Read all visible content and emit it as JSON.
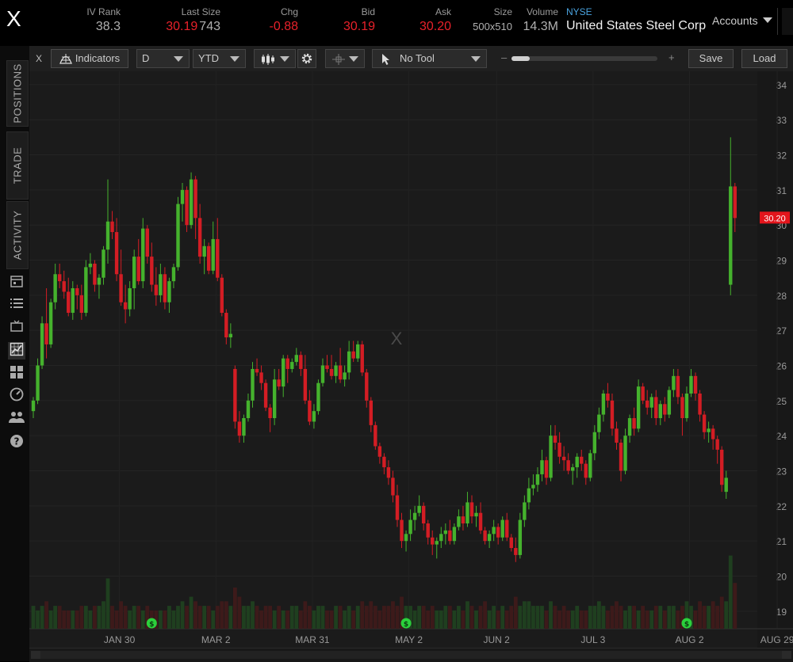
{
  "header": {
    "symbol": "X",
    "iv_rank_label": "IV Rank",
    "iv_rank": "38.3",
    "last_size_label": "Last Size",
    "last": "30.19",
    "last_size": "743",
    "chg_label": "Chg",
    "chg": "-0.88",
    "bid_label": "Bid",
    "bid": "30.19",
    "ask_label": "Ask",
    "ask": "30.20",
    "size_label": "Size",
    "size": "500x510",
    "volume_label": "Volume",
    "volume": "14.3M",
    "exchange": "NYSE",
    "company": "United States Steel Corp",
    "accounts": "Accounts"
  },
  "sidebar": {
    "tabs": [
      "POSITIONS",
      "TRADE",
      "ACTIVITY"
    ],
    "icons": [
      "calendar-icon",
      "list-icon",
      "tv-icon",
      "chart-icon",
      "grid-icon",
      "gauge-icon",
      "people-icon",
      "help-icon"
    ]
  },
  "toolbar": {
    "close": "X",
    "indicators": "Indicators",
    "interval": "D",
    "range": "YTD",
    "tool": "No Tool",
    "zoom_minus": "–",
    "zoom_plus": "+",
    "zoom_level": 0.12,
    "save": "Save",
    "load": "Load",
    "expand": ">"
  },
  "colors": {
    "up": "#45b22d",
    "down": "#d31d24",
    "price_tag": "#e3151c",
    "dividend": "#2bd13c"
  },
  "chart_data": {
    "type": "candlestick",
    "watermark": "X",
    "y_ticks": [
      19,
      20,
      21,
      22,
      23,
      24,
      25,
      26,
      27,
      28,
      29,
      30,
      31,
      32,
      33,
      34
    ],
    "ylim": [
      18.5,
      34.2
    ],
    "x_labels": [
      "JAN 30",
      "MAR 2",
      "MAR 31",
      "MAY 2",
      "JUN 2",
      "JUL 3",
      "AUG 2",
      "AUG 29"
    ],
    "price_tag": "30.20",
    "dividend_markers": [
      "JAN 30",
      "MAY 2",
      "AUG 2"
    ],
    "candles": [
      [
        24.7,
        25.1,
        24.5,
        25.0
      ],
      [
        25.0,
        26.2,
        24.9,
        26.0
      ],
      [
        26.0,
        27.4,
        25.9,
        27.2
      ],
      [
        27.2,
        28.2,
        26.2,
        26.6
      ],
      [
        26.6,
        27.9,
        26.5,
        27.8
      ],
      [
        27.8,
        28.9,
        27.6,
        28.6
      ],
      [
        28.6,
        28.9,
        28.2,
        28.4
      ],
      [
        28.4,
        28.7,
        27.9,
        28.1
      ],
      [
        28.1,
        28.5,
        27.4,
        27.5
      ],
      [
        27.5,
        28.4,
        27.3,
        28.2
      ],
      [
        28.2,
        28.3,
        27.6,
        28.0
      ],
      [
        28.0,
        28.3,
        27.3,
        27.5
      ],
      [
        27.5,
        29.0,
        27.4,
        28.8
      ],
      [
        28.8,
        29.2,
        28.6,
        28.9
      ],
      [
        28.9,
        29.0,
        28.1,
        28.3
      ],
      [
        28.3,
        28.6,
        27.9,
        28.5
      ],
      [
        28.5,
        29.4,
        28.3,
        29.3
      ],
      [
        29.3,
        31.3,
        28.9,
        30.1
      ],
      [
        30.1,
        30.4,
        29.6,
        29.8
      ],
      [
        29.8,
        30.2,
        28.4,
        28.6
      ],
      [
        28.6,
        29.3,
        27.7,
        27.8
      ],
      [
        27.8,
        28.3,
        27.2,
        27.6
      ],
      [
        27.6,
        28.4,
        27.4,
        28.2
      ],
      [
        28.2,
        29.3,
        27.6,
        29.1
      ],
      [
        29.1,
        29.6,
        28.3,
        28.4
      ],
      [
        28.4,
        30.2,
        28.2,
        29.9
      ],
      [
        29.9,
        30.0,
        28.9,
        29.1
      ],
      [
        29.1,
        29.5,
        28.1,
        28.3
      ],
      [
        28.3,
        28.8,
        27.7,
        28.0
      ],
      [
        28.0,
        28.9,
        27.8,
        28.6
      ],
      [
        28.6,
        28.8,
        27.6,
        27.8
      ],
      [
        27.8,
        28.5,
        27.5,
        28.4
      ],
      [
        28.4,
        28.9,
        28.2,
        28.8
      ],
      [
        28.8,
        30.8,
        28.7,
        30.6
      ],
      [
        30.6,
        31.2,
        30.1,
        31.0
      ],
      [
        31.0,
        31.1,
        29.8,
        30.0
      ],
      [
        30.0,
        31.5,
        29.9,
        31.3
      ],
      [
        31.3,
        31.4,
        29.6,
        30.2
      ],
      [
        30.2,
        30.6,
        28.9,
        29.1
      ],
      [
        29.1,
        29.6,
        28.6,
        29.4
      ],
      [
        29.4,
        29.5,
        28.6,
        28.7
      ],
      [
        28.7,
        30.1,
        28.6,
        29.6
      ],
      [
        29.6,
        30.2,
        28.4,
        28.5
      ],
      [
        28.5,
        28.6,
        27.4,
        27.5
      ],
      [
        27.5,
        27.6,
        26.6,
        26.8
      ],
      [
        26.8,
        27.2,
        26.5,
        26.9
      ],
      [
        25.9,
        26.0,
        24.2,
        24.4
      ],
      [
        24.4,
        24.7,
        23.8,
        24.0
      ],
      [
        24.0,
        24.6,
        23.8,
        24.5
      ],
      [
        24.5,
        25.2,
        24.4,
        25.0
      ],
      [
        25.0,
        26.1,
        24.8,
        25.9
      ],
      [
        25.9,
        26.2,
        25.7,
        25.8
      ],
      [
        25.8,
        26.0,
        25.3,
        25.5
      ],
      [
        25.5,
        25.6,
        24.7,
        24.8
      ],
      [
        24.8,
        24.9,
        24.1,
        24.5
      ],
      [
        24.5,
        25.9,
        24.3,
        25.6
      ],
      [
        25.6,
        25.9,
        25.3,
        25.4
      ],
      [
        25.4,
        26.3,
        25.1,
        26.2
      ],
      [
        26.2,
        26.3,
        25.5,
        25.9
      ],
      [
        25.9,
        26.2,
        25.8,
        26.1
      ],
      [
        26.1,
        26.5,
        26.0,
        26.3
      ],
      [
        26.3,
        26.4,
        25.7,
        25.9
      ],
      [
        25.9,
        26.3,
        24.9,
        25.0
      ],
      [
        25.0,
        25.3,
        24.3,
        24.4
      ],
      [
        24.4,
        24.9,
        24.2,
        24.7
      ],
      [
        24.7,
        25.6,
        24.6,
        25.5
      ],
      [
        25.5,
        26.2,
        25.4,
        26.0
      ],
      [
        26.0,
        26.3,
        25.8,
        25.9
      ],
      [
        25.9,
        26.3,
        25.6,
        25.7
      ],
      [
        25.7,
        26.1,
        25.5,
        26.0
      ],
      [
        26.0,
        26.5,
        25.5,
        25.6
      ],
      [
        25.6,
        26.0,
        25.4,
        25.8
      ],
      [
        25.8,
        26.7,
        25.6,
        26.4
      ],
      [
        26.4,
        26.7,
        26.1,
        26.2
      ],
      [
        26.2,
        26.7,
        26.1,
        26.6
      ],
      [
        26.6,
        26.7,
        25.7,
        25.8
      ],
      [
        25.8,
        25.9,
        24.8,
        25.0
      ],
      [
        25.0,
        25.1,
        24.1,
        24.3
      ],
      [
        24.3,
        24.4,
        23.6,
        23.7
      ],
      [
        23.7,
        23.8,
        23.2,
        23.4
      ],
      [
        23.4,
        23.5,
        22.9,
        23.1
      ],
      [
        23.1,
        23.3,
        22.6,
        22.8
      ],
      [
        22.8,
        23.0,
        22.1,
        22.3
      ],
      [
        22.3,
        22.6,
        21.4,
        21.6
      ],
      [
        21.6,
        21.8,
        20.8,
        21.0
      ],
      [
        21.0,
        21.3,
        20.7,
        21.2
      ],
      [
        21.2,
        21.9,
        21.0,
        21.6
      ],
      [
        21.6,
        22.0,
        21.3,
        21.8
      ],
      [
        21.8,
        22.3,
        21.7,
        22.0
      ],
      [
        22.0,
        22.1,
        21.3,
        21.5
      ],
      [
        21.5,
        21.6,
        20.9,
        21.1
      ],
      [
        21.1,
        21.3,
        20.6,
        20.9
      ],
      [
        20.9,
        21.1,
        20.5,
        21.0
      ],
      [
        21.0,
        21.4,
        20.8,
        21.2
      ],
      [
        21.2,
        21.5,
        20.9,
        21.3
      ],
      [
        21.3,
        21.6,
        20.9,
        21.0
      ],
      [
        21.0,
        21.5,
        20.9,
        21.4
      ],
      [
        21.4,
        21.9,
        21.3,
        21.7
      ],
      [
        21.7,
        22.0,
        21.3,
        21.5
      ],
      [
        21.5,
        22.4,
        21.4,
        22.1
      ],
      [
        22.1,
        22.3,
        21.5,
        21.7
      ],
      [
        21.7,
        22.0,
        21.4,
        21.8
      ],
      [
        21.8,
        22.1,
        21.2,
        21.3
      ],
      [
        21.3,
        21.4,
        20.9,
        21.0
      ],
      [
        21.0,
        21.3,
        20.8,
        21.2
      ],
      [
        21.2,
        21.6,
        21.0,
        21.4
      ],
      [
        21.4,
        21.5,
        20.9,
        21.1
      ],
      [
        21.1,
        21.7,
        21.0,
        21.6
      ],
      [
        21.6,
        21.8,
        21.0,
        21.1
      ],
      [
        21.1,
        21.2,
        20.7,
        20.8
      ],
      [
        20.8,
        21.1,
        20.4,
        20.6
      ],
      [
        20.6,
        21.8,
        20.5,
        21.6
      ],
      [
        21.6,
        22.3,
        21.4,
        22.1
      ],
      [
        22.1,
        22.8,
        21.9,
        22.5
      ],
      [
        22.5,
        22.9,
        22.3,
        22.6
      ],
      [
        22.6,
        23.1,
        22.4,
        22.9
      ],
      [
        22.9,
        23.6,
        22.7,
        23.3
      ],
      [
        23.3,
        23.4,
        22.6,
        22.8
      ],
      [
        22.8,
        24.3,
        22.7,
        24.0
      ],
      [
        24.0,
        24.3,
        23.6,
        23.8
      ],
      [
        23.8,
        24.1,
        23.2,
        23.4
      ],
      [
        23.4,
        23.7,
        23.0,
        23.3
      ],
      [
        23.3,
        23.5,
        22.9,
        23.0
      ],
      [
        23.0,
        23.2,
        22.6,
        23.1
      ],
      [
        23.1,
        23.5,
        22.8,
        23.4
      ],
      [
        23.4,
        23.6,
        23.0,
        23.2
      ],
      [
        23.2,
        23.3,
        22.6,
        22.8
      ],
      [
        22.8,
        23.6,
        22.7,
        23.5
      ],
      [
        23.5,
        24.3,
        23.3,
        24.1
      ],
      [
        24.1,
        24.8,
        23.9,
        24.6
      ],
      [
        24.6,
        25.3,
        24.4,
        25.2
      ],
      [
        25.2,
        25.5,
        24.8,
        25.0
      ],
      [
        25.0,
        25.2,
        24.0,
        24.2
      ],
      [
        24.2,
        24.4,
        23.6,
        23.8
      ],
      [
        23.8,
        23.9,
        22.7,
        23.0
      ],
      [
        23.0,
        24.2,
        22.9,
        24.0
      ],
      [
        24.0,
        24.6,
        23.8,
        24.5
      ],
      [
        24.5,
        24.8,
        24.0,
        24.2
      ],
      [
        24.2,
        25.6,
        24.1,
        25.4
      ],
      [
        25.4,
        25.5,
        24.9,
        25.0
      ],
      [
        25.0,
        25.3,
        24.6,
        24.8
      ],
      [
        24.8,
        25.2,
        24.5,
        25.1
      ],
      [
        25.1,
        25.3,
        24.3,
        24.5
      ],
      [
        24.5,
        25.0,
        24.3,
        24.9
      ],
      [
        24.9,
        25.1,
        24.4,
        24.6
      ],
      [
        24.6,
        25.4,
        24.5,
        25.3
      ],
      [
        25.3,
        25.9,
        25.1,
        25.7
      ],
      [
        25.7,
        25.9,
        24.9,
        25.1
      ],
      [
        25.1,
        25.2,
        24.0,
        24.5
      ],
      [
        24.5,
        25.4,
        24.4,
        25.2
      ],
      [
        25.2,
        25.9,
        25.1,
        25.7
      ],
      [
        25.7,
        25.8,
        25.0,
        25.2
      ],
      [
        25.2,
        25.3,
        24.4,
        24.6
      ],
      [
        24.6,
        24.7,
        23.9,
        24.1
      ],
      [
        24.1,
        24.4,
        23.8,
        24.2
      ],
      [
        24.2,
        24.3,
        23.6,
        23.9
      ],
      [
        23.9,
        24.0,
        23.2,
        23.6
      ],
      [
        23.6,
        23.7,
        22.4,
        22.6
      ],
      [
        22.4,
        23.0,
        22.2,
        22.8
      ],
      [
        28.3,
        32.5,
        28.0,
        31.1
      ],
      [
        31.1,
        31.2,
        29.8,
        30.2
      ]
    ],
    "volume_ylim": [
      0,
      18
    ],
    "volumes": [
      5,
      4,
      5,
      6,
      4,
      5,
      5,
      4,
      4,
      4,
      4,
      5,
      5,
      4,
      5,
      5,
      6,
      11,
      5,
      4,
      6,
      5,
      4,
      5,
      5,
      4,
      5,
      4,
      4,
      4,
      4,
      5,
      4,
      5,
      6,
      5,
      7,
      6,
      5,
      5,
      5,
      4,
      5,
      6,
      6,
      5,
      9,
      7,
      5,
      5,
      6,
      5,
      4,
      5,
      5,
      4,
      5,
      4,
      4,
      5,
      5,
      4,
      6,
      5,
      4,
      5,
      5,
      4,
      4,
      5,
      5,
      4,
      5,
      4,
      5,
      6,
      5,
      6,
      5,
      4,
      5,
      5,
      6,
      5,
      7,
      5,
      5,
      4,
      5,
      5,
      4,
      5,
      4,
      4,
      5,
      5,
      4,
      5,
      4,
      6,
      5,
      4,
      5,
      6,
      4,
      5,
      4,
      5,
      4,
      5,
      7,
      5,
      6,
      6,
      5,
      5,
      5,
      4,
      6,
      5,
      4,
      5,
      4,
      4,
      5,
      4,
      4,
      5,
      5,
      6,
      5,
      4,
      5,
      6,
      5,
      4,
      5,
      5,
      4,
      5,
      4,
      4,
      5,
      5,
      4,
      5,
      5,
      4,
      5,
      6,
      5,
      4,
      6,
      5,
      5,
      6,
      5,
      7,
      6,
      16,
      10
    ]
  }
}
